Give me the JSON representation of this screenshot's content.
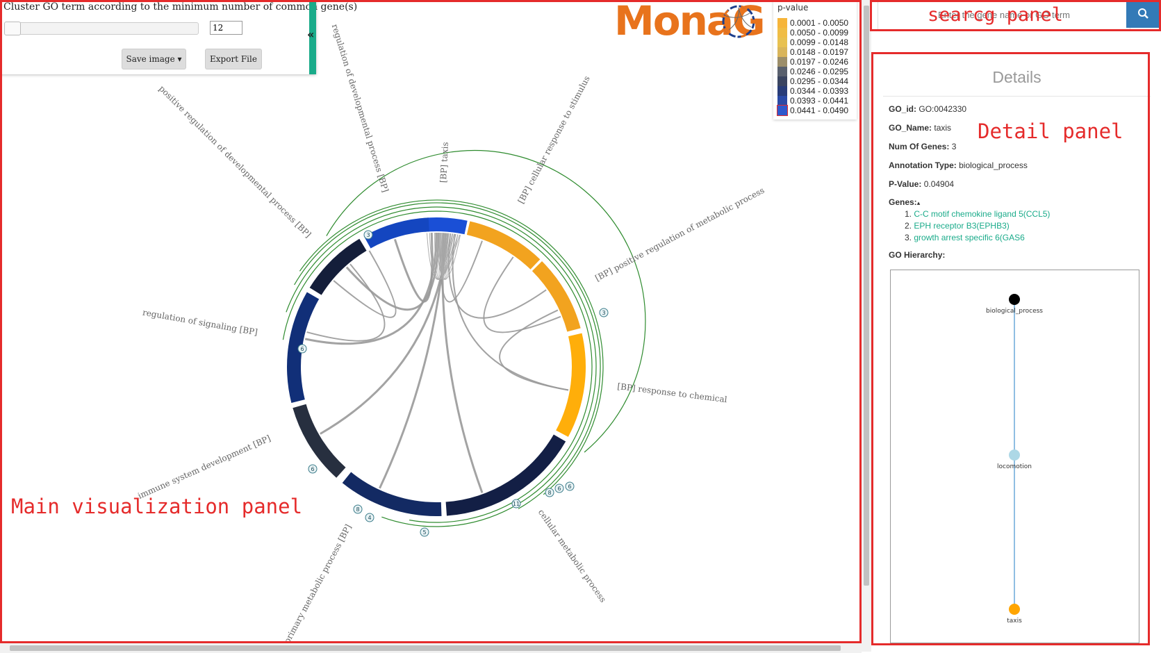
{
  "controls": {
    "cluster_label": "Cluster GO term according to the minimum number of common gene(s)",
    "min_genes_value": "12",
    "save_image_label": "Save image ▾",
    "export_file_label": "Export File",
    "collapse_icon": "double-chevron-left-icon",
    "collapse_glyph": "«"
  },
  "logo": {
    "text": "MonaG",
    "icon": "chord-circle-logo-icon"
  },
  "legend": {
    "title": "p-value",
    "items": [
      {
        "label": "0.0001 - 0.0050",
        "color": "#f6b53a"
      },
      {
        "label": "0.0050 - 0.0099",
        "color": "#f0bd45"
      },
      {
        "label": "0.0099 - 0.0148",
        "color": "#e8c150"
      },
      {
        "label": "0.0148 - 0.0197",
        "color": "#d9b55a"
      },
      {
        "label": "0.0197 - 0.0246",
        "color": "#9c8e6a"
      },
      {
        "label": "0.0246 - 0.0295",
        "color": "#59606d"
      },
      {
        "label": "0.0295 - 0.0344",
        "color": "#3a4460"
      },
      {
        "label": "0.0344 - 0.0393",
        "color": "#283c78"
      },
      {
        "label": "0.0393 - 0.0441",
        "color": "#2a4aa6"
      },
      {
        "label": "0.0441 - 0.0490",
        "color": "#2e58cc"
      }
    ]
  },
  "chord": {
    "terms": [
      "[BP] taxis",
      "[BP] cellular response to stimulus",
      "[BP] positive regulation of metabolic process",
      "[BP] response to chemical",
      "cellular metabolic process",
      "primary metabolic process [BP]",
      "immune system development [BP]",
      "regulation of signaling [BP]",
      "positive regulation of developmental process [BP]",
      "regulation of developmental process [BP]"
    ],
    "arc_colors": [
      "#1a4fd6",
      "#f2a31f",
      "#f2a31f",
      "#ffae0a",
      "#131f45",
      "#132a63",
      "#272f3f",
      "#112f78",
      "#141e3a",
      "#1446c0"
    ],
    "badges": [
      "3",
      "3",
      "6",
      "6",
      "6",
      "4",
      "6",
      "8",
      "8",
      "5",
      "11"
    ]
  },
  "search": {
    "placeholder": "Enter the gene name or GO term",
    "icon": "search-icon"
  },
  "details": {
    "title": "Details",
    "go_id_label": "GO_id:",
    "go_id": "GO:0042330",
    "go_name_label": "GO_Name:",
    "go_name": "taxis",
    "num_genes_label": "Num Of Genes:",
    "num_genes": "3",
    "annotation_label": "Annotation Type:",
    "annotation": "biological_process",
    "pvalue_label": "P-Value:",
    "pvalue": "0.04904",
    "genes_label": "Genes:",
    "genes_caret": "▴",
    "genes": [
      {
        "num": "1.",
        "name": "C-C motif chemokine ligand 5(CCL5)"
      },
      {
        "num": "2.",
        "name": "EPH receptor B3(EPHB3)"
      },
      {
        "num": "3.",
        "name": "growth arrest specific 6(GAS6"
      }
    ],
    "hierarchy_label": "GO Hierarchy:",
    "hierarchy": [
      {
        "name": "biological_process",
        "color": "#000000"
      },
      {
        "name": "locomotion",
        "color": "#add8e6"
      },
      {
        "name": "taxis",
        "color": "#ffa500"
      }
    ]
  },
  "annotations": {
    "main": "Main visualization panel",
    "search": "searcg panel",
    "detail": "Detail panel"
  }
}
